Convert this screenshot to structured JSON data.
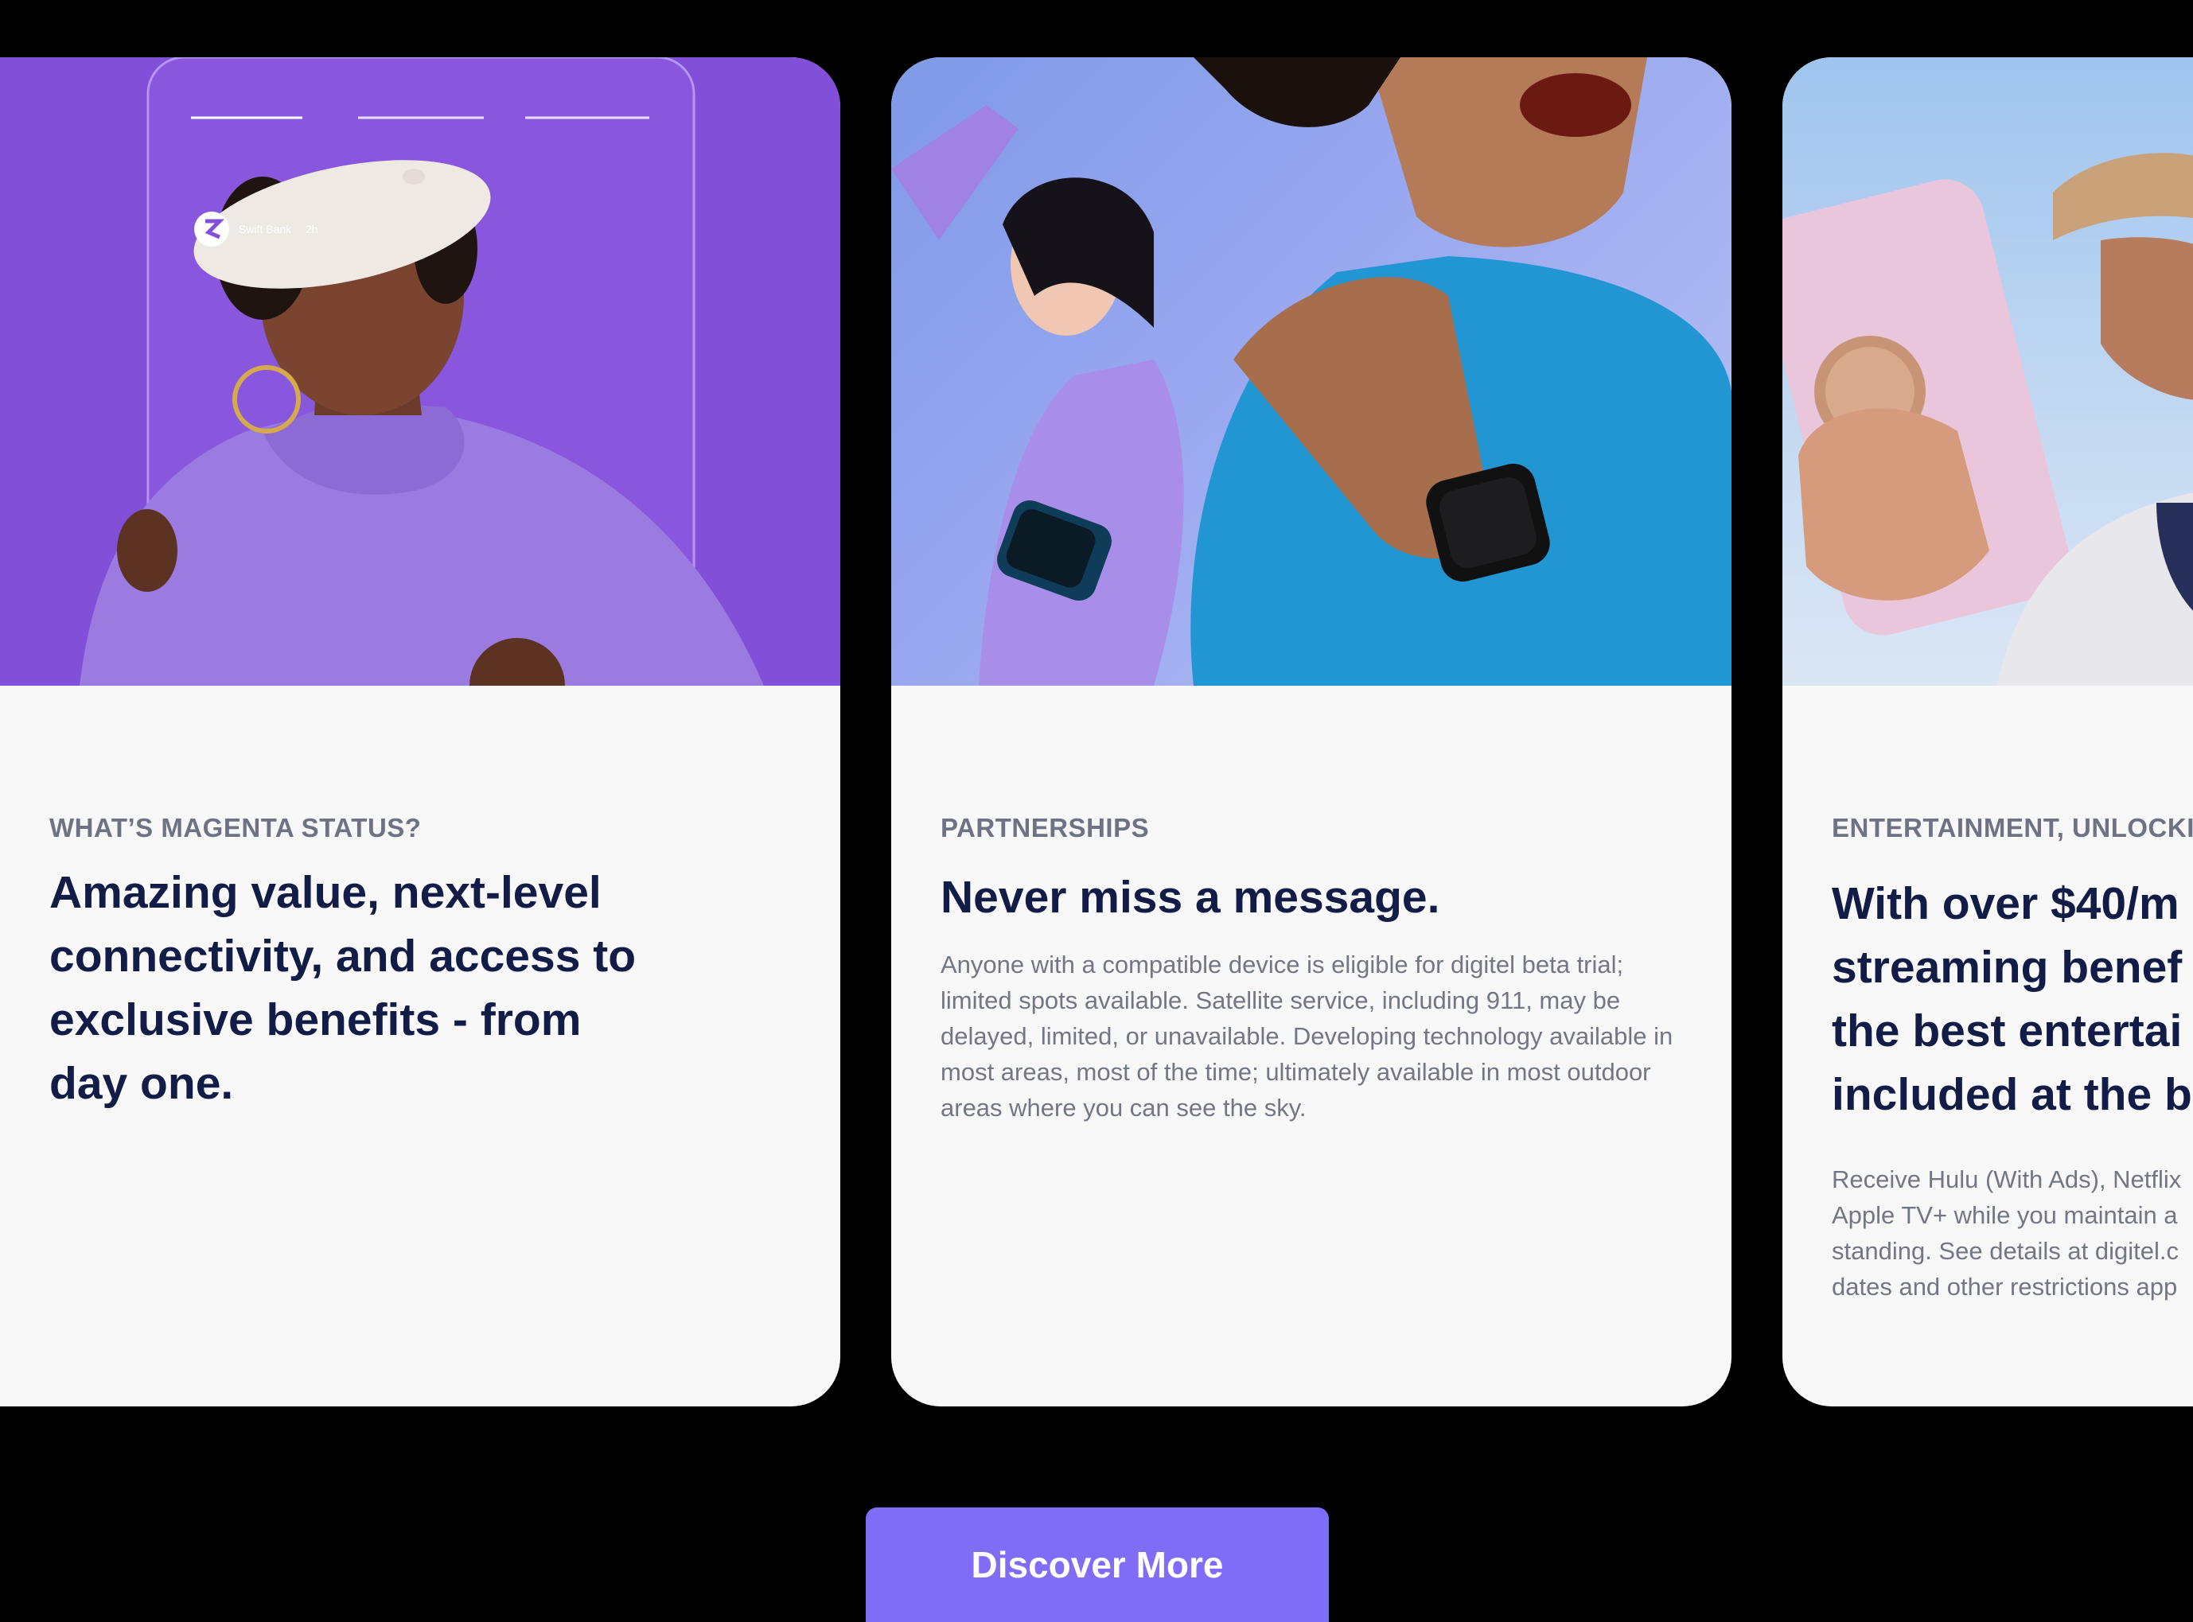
{
  "cards": [
    {
      "eyebrow": "WHAT’S MAGENTA STATUS?",
      "headline": "Amazing value, next-level connectivity, and access to exclusive benefits - from day one.",
      "image_overlay": {
        "brand": "Swift Bank",
        "time": "2h"
      },
      "colors": {
        "photo_bg": "#8250d8",
        "sweater": "#9b7be0"
      }
    },
    {
      "eyebrow": "PARTNERSHIPS",
      "headline": "Never miss a message.",
      "body": "Anyone with a compatible device is eligible for digitel beta trial; limited spots available. Satellite service, including 911, may be delayed, limited, or unavailable. Developing technology available in most areas, most of the time; ultimately available in most outdoor areas where you can see the sky.",
      "colors": {
        "photo_bg": "#8fa2ec",
        "shirt": "#2196d3"
      }
    },
    {
      "eyebrow": "ENTERTAINMENT, UNLOCKI",
      "headline_lines": [
        "With over $40/m",
        "streaming benef",
        "the best entertai",
        "included at the b"
      ],
      "body_lines": [
        "Receive Hulu (With Ads), Netflix",
        "Apple TV+ while you maintain a",
        "standing. See details at digitel.c",
        "dates and other restrictions app"
      ],
      "colors": {
        "photo_bg": "#b8d2f0",
        "phone": "#e9c6dc"
      }
    }
  ],
  "cta": {
    "label": "Discover More",
    "color": "#7f6df7"
  },
  "colors": {
    "page_bg": "#000000",
    "card_bg": "#f8f8f8",
    "heading": "#111c47",
    "eyebrow": "#6d7384"
  }
}
